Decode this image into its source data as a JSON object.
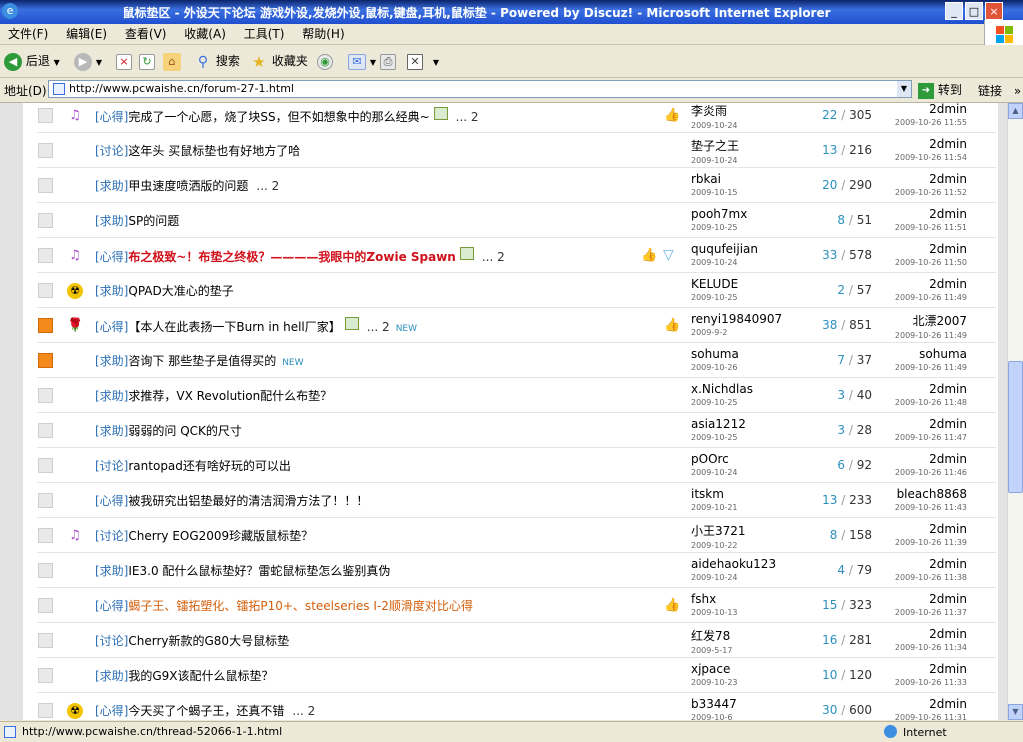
{
  "window": {
    "title": "鼠标垫区 - 外设天下论坛 游戏外设,发烧外设,鼠标,键盘,耳机,鼠标垫 - Powered by Discuz! - Microsoft Internet Explorer",
    "minimize": "_",
    "maximize": "□",
    "close": "×"
  },
  "menu": [
    "文件(F)",
    "编辑(E)",
    "查看(V)",
    "收藏(A)",
    "工具(T)",
    "帮助(H)"
  ],
  "toolbar": {
    "back": "后退",
    "search": "搜索",
    "favorites": "收藏夹"
  },
  "address": {
    "label": "地址(D)",
    "url": "http://www.pcwaishe.cn/forum-27-1.html",
    "go": "转到",
    "links": "链接",
    "chevron": "»"
  },
  "threads": [
    {
      "folder": "normal",
      "icon": "music",
      "category": "[心得]",
      "title": "完成了一个心愿，烧了块SS，但不如想象中的那么经典~",
      "style": "normal",
      "has_image": true,
      "pages": "... 2",
      "is_new": false,
      "thumb": true,
      "diamond": false,
      "author": "李炎雨",
      "author_date": "2009-10-24",
      "replies": "22",
      "views": "305",
      "last_user": "2dmin",
      "last_time": "2009-10-26 11:55"
    },
    {
      "folder": "normal",
      "icon": "",
      "category": "[讨论]",
      "title": "这年头 买鼠标垫也有好地方了哈",
      "style": "normal",
      "has_image": false,
      "pages": "",
      "is_new": false,
      "thumb": false,
      "diamond": false,
      "author": "垫子之王",
      "author_date": "2009-10-24",
      "replies": "13",
      "views": "216",
      "last_user": "2dmin",
      "last_time": "2009-10-26 11:54"
    },
    {
      "folder": "normal",
      "icon": "",
      "category": "[求助]",
      "title": "甲虫速度喷洒版的问题",
      "style": "normal",
      "has_image": false,
      "pages": "... 2",
      "is_new": false,
      "thumb": false,
      "diamond": false,
      "author": "rbkai",
      "author_date": "2009-10-15",
      "replies": "20",
      "views": "290",
      "last_user": "2dmin",
      "last_time": "2009-10-26 11:52"
    },
    {
      "folder": "normal",
      "icon": "",
      "category": "[求助]",
      "title": "SP的问题",
      "style": "normal",
      "has_image": false,
      "pages": "",
      "is_new": false,
      "thumb": false,
      "diamond": false,
      "author": "pooh7mx",
      "author_date": "2009-10-25",
      "replies": "8",
      "views": "51",
      "last_user": "2dmin",
      "last_time": "2009-10-26 11:51"
    },
    {
      "folder": "normal",
      "icon": "music",
      "category": "[心得]",
      "title": "布之极致~！布垫之终极？————我眼中的Zowie Spawn",
      "style": "red",
      "has_image": true,
      "pages": "... 2",
      "is_new": false,
      "thumb": true,
      "diamond": true,
      "author": "ququfeijian",
      "author_date": "2009-10-24",
      "replies": "33",
      "views": "578",
      "last_user": "2dmin",
      "last_time": "2009-10-26 11:50"
    },
    {
      "folder": "normal",
      "icon": "radioactive",
      "category": "[求助]",
      "title": "QPAD大准心的垫子",
      "style": "normal",
      "has_image": false,
      "pages": "",
      "is_new": false,
      "thumb": false,
      "diamond": false,
      "author": "KELUDE",
      "author_date": "2009-10-25",
      "replies": "2",
      "views": "57",
      "last_user": "2dmin",
      "last_time": "2009-10-26 11:49"
    },
    {
      "folder": "hot",
      "icon": "rose",
      "category": "[心得]",
      "title": "【本人在此表扬一下Burn in hell厂家】",
      "style": "normal",
      "has_image": true,
      "pages": "... 2",
      "is_new": true,
      "thumb": true,
      "diamond": false,
      "author": "renyi19840907",
      "author_date": "2009-9-2",
      "replies": "38",
      "views": "851",
      "last_user": "北漂2007",
      "last_time": "2009-10-26 11:49"
    },
    {
      "folder": "hot",
      "icon": "",
      "category": "[求助]",
      "title": "咨询下 那些垫子是值得买的",
      "style": "normal",
      "has_image": false,
      "pages": "",
      "is_new": true,
      "thumb": false,
      "diamond": false,
      "author": "sohuma",
      "author_date": "2009-10-26",
      "replies": "7",
      "views": "37",
      "last_user": "sohuma",
      "last_time": "2009-10-26 11:49"
    },
    {
      "folder": "normal",
      "icon": "",
      "category": "[求助]",
      "title": "求推荐，VX Revolution配什么布垫？",
      "style": "normal",
      "has_image": false,
      "pages": "",
      "is_new": false,
      "thumb": false,
      "diamond": false,
      "author": "x.Nichdlas",
      "author_date": "2009-10-25",
      "replies": "3",
      "views": "40",
      "last_user": "2dmin",
      "last_time": "2009-10-26 11:48"
    },
    {
      "folder": "normal",
      "icon": "",
      "category": "[求助]",
      "title": "弱弱的问 QCK的尺寸",
      "style": "normal",
      "has_image": false,
      "pages": "",
      "is_new": false,
      "thumb": false,
      "diamond": false,
      "author": "asia1212",
      "author_date": "2009-10-25",
      "replies": "3",
      "views": "28",
      "last_user": "2dmin",
      "last_time": "2009-10-26 11:47"
    },
    {
      "folder": "normal",
      "icon": "",
      "category": "[讨论]",
      "title": "rantopad还有啥好玩的可以出",
      "style": "normal",
      "has_image": false,
      "pages": "",
      "is_new": false,
      "thumb": false,
      "diamond": false,
      "author": "pOOrc",
      "author_date": "2009-10-24",
      "replies": "6",
      "views": "92",
      "last_user": "2dmin",
      "last_time": "2009-10-26 11:46"
    },
    {
      "folder": "normal",
      "icon": "",
      "category": "[心得]",
      "title": "被我研究出铝垫最好的清洁润滑方法了！！！",
      "style": "normal",
      "has_image": false,
      "pages": "",
      "is_new": false,
      "thumb": false,
      "diamond": false,
      "author": "itskm",
      "author_date": "2009-10-21",
      "replies": "13",
      "views": "233",
      "last_user": "bleach8868",
      "last_time": "2009-10-26 11:43"
    },
    {
      "folder": "normal",
      "icon": "music",
      "category": "[讨论]",
      "title": "Cherry EOG2009珍藏版鼠标垫？",
      "style": "normal",
      "has_image": false,
      "pages": "",
      "is_new": false,
      "thumb": false,
      "diamond": false,
      "author": "小王3721",
      "author_date": "2009-10-22",
      "replies": "8",
      "views": "158",
      "last_user": "2dmin",
      "last_time": "2009-10-26 11:39"
    },
    {
      "folder": "normal",
      "icon": "",
      "category": "[求助]",
      "title": "IE3.0 配什么鼠标垫好？雷蛇鼠标垫怎么鉴别真伪",
      "style": "normal",
      "has_image": false,
      "pages": "",
      "is_new": false,
      "thumb": false,
      "diamond": false,
      "author": "aidehaoku123",
      "author_date": "2009-10-24",
      "replies": "4",
      "views": "79",
      "last_user": "2dmin",
      "last_time": "2009-10-26 11:38"
    },
    {
      "folder": "normal",
      "icon": "",
      "category": "[心得]",
      "title": "蝎子王、镭拓塑化、镭拓P10+、steelseries I-2顺滑度对比心得",
      "style": "orange",
      "has_image": false,
      "pages": "",
      "is_new": false,
      "thumb": true,
      "diamond": false,
      "author": "fshx",
      "author_date": "2009-10-13",
      "replies": "15",
      "views": "323",
      "last_user": "2dmin",
      "last_time": "2009-10-26 11:37"
    },
    {
      "folder": "normal",
      "icon": "",
      "category": "[讨论]",
      "title": "Cherry新款的G80大号鼠标垫",
      "style": "normal",
      "has_image": false,
      "pages": "",
      "is_new": false,
      "thumb": false,
      "diamond": false,
      "author": "红发78",
      "author_date": "2009-5-17",
      "replies": "16",
      "views": "281",
      "last_user": "2dmin",
      "last_time": "2009-10-26 11:34"
    },
    {
      "folder": "normal",
      "icon": "",
      "category": "[求助]",
      "title": "我的G9X该配什么鼠标垫？",
      "style": "normal",
      "has_image": false,
      "pages": "",
      "is_new": false,
      "thumb": false,
      "diamond": false,
      "author": "xjpace",
      "author_date": "2009-10-23",
      "replies": "10",
      "views": "120",
      "last_user": "2dmin",
      "last_time": "2009-10-26 11:33"
    },
    {
      "folder": "normal",
      "icon": "radioactive",
      "category": "[心得]",
      "title": "今天买了个蝎子王，还真不错",
      "style": "normal",
      "has_image": false,
      "pages": "... 2",
      "is_new": false,
      "thumb": false,
      "diamond": false,
      "author": "b33447",
      "author_date": "2009-10-6",
      "replies": "30",
      "views": "600",
      "last_user": "2dmin",
      "last_time": "2009-10-26 11:31"
    }
  ],
  "new_label": "NEW",
  "status": {
    "text": "http://www.pcwaishe.cn/thread-52066-1-1.html",
    "zone": "Internet"
  }
}
